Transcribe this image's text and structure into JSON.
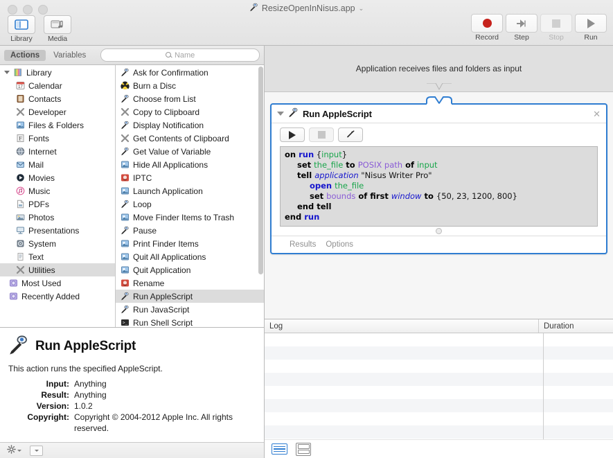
{
  "window": {
    "title": "ResizeOpenInNisus.app",
    "title_chevron": "⌄"
  },
  "toolbar": {
    "left_buttons": [
      {
        "label": "Library",
        "icon": "library-icon"
      },
      {
        "label": "Media",
        "icon": "media-icon"
      }
    ],
    "right_buttons": [
      {
        "label": "Record",
        "icon": "record-icon",
        "disabled": false
      },
      {
        "label": "Step",
        "icon": "step-icon",
        "disabled": false
      },
      {
        "label": "Stop",
        "icon": "stop-icon",
        "disabled": true
      },
      {
        "label": "Run",
        "icon": "run-icon",
        "disabled": false
      }
    ]
  },
  "tabs": {
    "actions": "Actions",
    "variables": "Variables"
  },
  "search": {
    "placeholder": "Name",
    "value": ""
  },
  "library_tree": {
    "root": "Library",
    "items": [
      {
        "label": "Calendar",
        "icon": "calendar-icon"
      },
      {
        "label": "Contacts",
        "icon": "contacts-icon"
      },
      {
        "label": "Developer",
        "icon": "developer-icon"
      },
      {
        "label": "Files & Folders",
        "icon": "files-folders-icon"
      },
      {
        "label": "Fonts",
        "icon": "fonts-icon"
      },
      {
        "label": "Internet",
        "icon": "internet-icon"
      },
      {
        "label": "Mail",
        "icon": "mail-icon"
      },
      {
        "label": "Movies",
        "icon": "movies-icon"
      },
      {
        "label": "Music",
        "icon": "music-icon"
      },
      {
        "label": "PDFs",
        "icon": "pdf-icon"
      },
      {
        "label": "Photos",
        "icon": "photos-icon"
      },
      {
        "label": "Presentations",
        "icon": "presentations-icon"
      },
      {
        "label": "System",
        "icon": "system-icon"
      },
      {
        "label": "Text",
        "icon": "text-icon"
      },
      {
        "label": "Utilities",
        "icon": "utilities-icon",
        "selected": true
      }
    ],
    "extra": [
      {
        "label": "Most Used",
        "icon": "smart-group-icon"
      },
      {
        "label": "Recently Added",
        "icon": "smart-group-icon"
      }
    ]
  },
  "actions_list": {
    "items": [
      {
        "label": "Ask for Confirmation",
        "icon": "applescript-icon"
      },
      {
        "label": "Burn a Disc",
        "icon": "burn-icon"
      },
      {
        "label": "Choose from List",
        "icon": "applescript-icon"
      },
      {
        "label": "Copy to Clipboard",
        "icon": "developer-icon"
      },
      {
        "label": "Display Notification",
        "icon": "applescript-icon"
      },
      {
        "label": "Get Contents of Clipboard",
        "icon": "developer-icon"
      },
      {
        "label": "Get Value of Variable",
        "icon": "applescript-icon"
      },
      {
        "label": "Hide All Applications",
        "icon": "files-folders-icon"
      },
      {
        "label": "IPTC",
        "icon": "iptc-icon"
      },
      {
        "label": "Launch Application",
        "icon": "files-folders-icon"
      },
      {
        "label": "Loop",
        "icon": "applescript-icon"
      },
      {
        "label": "Move Finder Items to Trash",
        "icon": "files-folders-icon"
      },
      {
        "label": "Pause",
        "icon": "applescript-icon"
      },
      {
        "label": "Print Finder Items",
        "icon": "files-folders-icon"
      },
      {
        "label": "Quit All Applications",
        "icon": "files-folders-icon"
      },
      {
        "label": "Quit Application",
        "icon": "files-folders-icon"
      },
      {
        "label": "Rename",
        "icon": "iptc-icon"
      },
      {
        "label": "Run AppleScript",
        "icon": "applescript-icon",
        "selected": true
      },
      {
        "label": "Run JavaScript",
        "icon": "applescript-icon"
      },
      {
        "label": "Run Shell Script",
        "icon": "shell-icon"
      }
    ]
  },
  "info_panel": {
    "title": "Run AppleScript",
    "description": "This action runs the specified AppleScript.",
    "fields": [
      {
        "key": "Input:",
        "value": "Anything"
      },
      {
        "key": "Result:",
        "value": "Anything"
      },
      {
        "key": "Version:",
        "value": "1.0.2"
      },
      {
        "key": "Copyright:",
        "value": "Copyright © 2004-2012 Apple Inc.  All rights reserved."
      }
    ]
  },
  "workflow": {
    "header_text": "Application receives files and folders as input"
  },
  "action_card": {
    "title": "Run AppleScript",
    "close_glyph": "✕",
    "buttons": [
      {
        "name": "run-script-button",
        "icon": "play-icon",
        "disabled": false
      },
      {
        "name": "stop-script-button",
        "icon": "stop-icon",
        "disabled": true
      },
      {
        "name": "compile-script-button",
        "icon": "hammer-icon",
        "disabled": false
      }
    ],
    "tabs": [
      "Results",
      "Options"
    ],
    "script_lines": [
      {
        "indent": 0,
        "tokens": [
          {
            "t": "on ",
            "c": "kw"
          },
          {
            "t": "run",
            "c": "hl"
          },
          {
            "t": " {",
            "c": "pl"
          },
          {
            "t": "input",
            "c": "var"
          },
          {
            "t": "}",
            "c": "pl"
          }
        ]
      },
      {
        "indent": 1,
        "tokens": [
          {
            "t": "set ",
            "c": "kw"
          },
          {
            "t": "the_file",
            "c": "var"
          },
          {
            "t": " to ",
            "c": "kw"
          },
          {
            "t": "POSIX path",
            "c": "cmd"
          },
          {
            "t": " of ",
            "c": "kw"
          },
          {
            "t": "input",
            "c": "var"
          }
        ]
      },
      {
        "indent": 1,
        "tokens": [
          {
            "t": "tell ",
            "c": "kw"
          },
          {
            "t": "application",
            "c": "it"
          },
          {
            "t": " \"Nisus Writer Pro\"",
            "c": "str"
          }
        ]
      },
      {
        "indent": 2,
        "tokens": [
          {
            "t": "open ",
            "c": "hl"
          },
          {
            "t": "the_file",
            "c": "var"
          }
        ]
      },
      {
        "indent": 2,
        "tokens": [
          {
            "t": "set ",
            "c": "kw"
          },
          {
            "t": "bounds",
            "c": "cmd"
          },
          {
            "t": " of first ",
            "c": "kw"
          },
          {
            "t": "window",
            "c": "it"
          },
          {
            "t": " to ",
            "c": "kw"
          },
          {
            "t": "{50, 23, 1200, 800}",
            "c": "str"
          }
        ]
      },
      {
        "indent": 1,
        "tokens": [
          {
            "t": "end tell",
            "c": "kw"
          }
        ]
      },
      {
        "indent": 0,
        "tokens": [
          {
            "t": "end ",
            "c": "kw"
          },
          {
            "t": "run",
            "c": "hl"
          }
        ]
      }
    ]
  },
  "log": {
    "columns": [
      "Log",
      "Duration"
    ],
    "rows": []
  },
  "colors": {
    "selection_blue": "#2f7dd1",
    "record_red": "#c6221c",
    "row_selected": "#dcdcdc",
    "canvas_bg": "#f6f6f6",
    "script_bg": "#dcdcdc"
  }
}
